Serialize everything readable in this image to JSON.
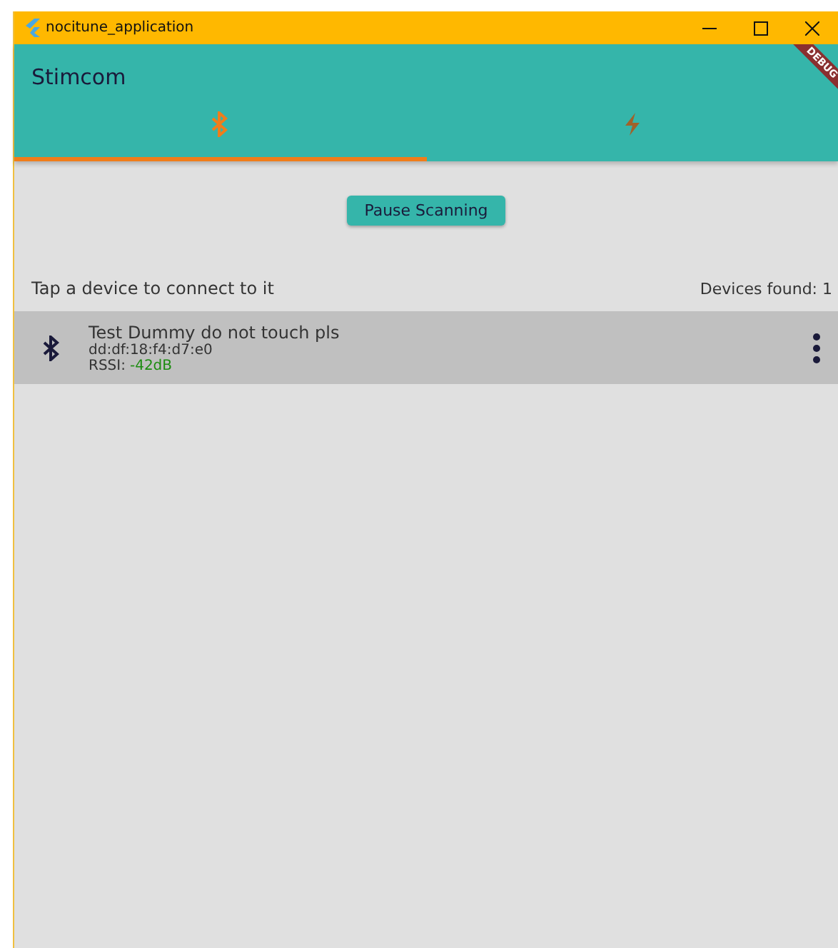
{
  "window": {
    "title": "nocitune_application"
  },
  "app_bar": {
    "title": "Stimcom",
    "debug_banner": "DEBUG"
  },
  "tabs": [
    {
      "kind": "bluetooth",
      "selected": true
    },
    {
      "kind": "bolt",
      "selected": false
    }
  ],
  "scan_button": "Pause Scanning",
  "hint": "Tap a device to connect to it",
  "devices_found": "Devices found: 1",
  "devices": [
    {
      "name": "Test Dummy do not touch pls",
      "address": "dd:df:18:f4:d7:e0",
      "rssi_label": "RSSI:",
      "rssi_value": "-42dB"
    }
  ]
}
